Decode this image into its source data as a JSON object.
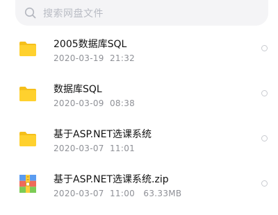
{
  "search": {
    "placeholder": "搜索网盘文件",
    "icon": "search-icon"
  },
  "files": [
    {
      "name": "2005数据库SQL",
      "date": "2020-03-19",
      "time": "21:32",
      "size": "",
      "type": "folder",
      "icon": "folder-icon"
    },
    {
      "name": "数据库SQL",
      "date": "2020-03-09",
      "time": "08:38",
      "size": "",
      "type": "folder",
      "icon": "folder-icon"
    },
    {
      "name": "基于ASP.NET选课系统",
      "date": "2020-03-07",
      "time": "11:01",
      "size": "",
      "type": "folder",
      "icon": "folder-icon"
    },
    {
      "name": "基于ASP.NET选课系统.zip",
      "date": "2020-03-07",
      "time": "11:00",
      "size": "63.33MB",
      "type": "zip",
      "icon": "zip-archive-icon"
    }
  ],
  "colors": {
    "folder": "#ffd12e",
    "folder_tab": "#f5bf1b",
    "search_bg": "#f4f4f6",
    "placeholder": "#b9bcc4",
    "meta_text": "#8e9096"
  }
}
